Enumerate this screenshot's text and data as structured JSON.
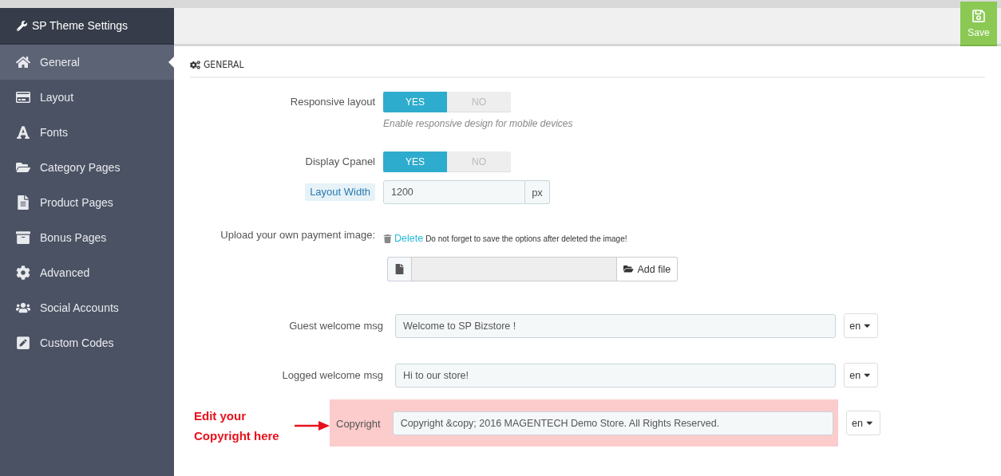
{
  "sidebar": {
    "title": "SP Theme Settings",
    "items": [
      {
        "label": "General",
        "selected": true
      },
      {
        "label": "Layout",
        "selected": false
      },
      {
        "label": "Fonts",
        "selected": false
      },
      {
        "label": "Category Pages",
        "selected": false
      },
      {
        "label": "Product Pages",
        "selected": false
      },
      {
        "label": "Bonus Pages",
        "selected": false
      },
      {
        "label": "Advanced",
        "selected": false
      },
      {
        "label": "Social Accounts",
        "selected": false
      },
      {
        "label": "Custom Codes",
        "selected": false
      }
    ]
  },
  "toolbar": {
    "save_label": "Save"
  },
  "section": {
    "title": "GENERAL"
  },
  "fields": [
    {
      "kind": "toggle",
      "label": "Responsive layout",
      "on": true,
      "yes": "YES",
      "no": "NO",
      "hint": "Enable responsive design for mobile devices"
    },
    {
      "kind": "toggle",
      "label": "Display Cpanel",
      "on": true,
      "yes": "YES",
      "no": "NO"
    },
    {
      "kind": "addon",
      "label": "Layout Width",
      "value": "1200",
      "addon": "px"
    },
    {
      "kind": "upload",
      "label": "Upload your own payment image:",
      "delete": "Delete",
      "note": "Do not forget to save the options after deleted the image!",
      "button": "Add file"
    },
    {
      "kind": "lang",
      "label": "Guest welcome msg",
      "value": "Welcome to SP Bizstore !",
      "lang": "en",
      "highlighted": false
    },
    {
      "kind": "lang",
      "label": "Logged welcome msg",
      "value": "Hi to our store!",
      "lang": "en",
      "highlighted": false
    },
    {
      "kind": "lang",
      "label": "Copyright",
      "value": "Copyright &copy; 2016 MAGENTECH Demo Store. All Rights Reserved.",
      "lang": "en",
      "highlighted": true,
      "annotation": "Edit your Copyright here"
    }
  ]
}
